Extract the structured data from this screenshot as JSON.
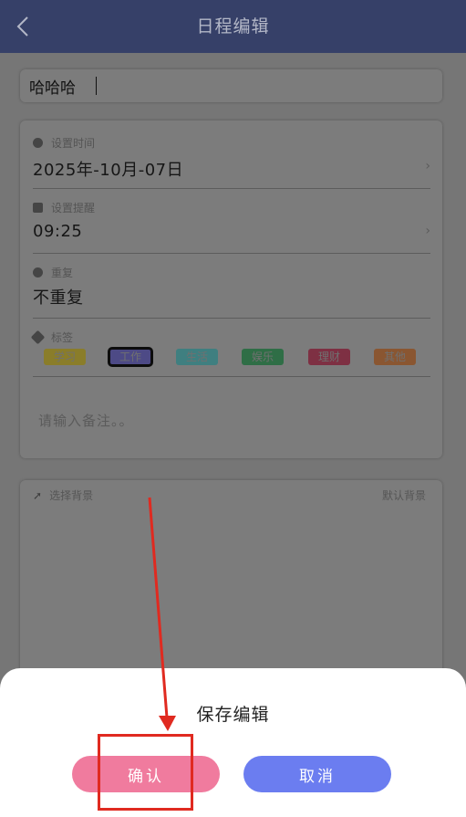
{
  "header": {
    "back_icon": "chevron-left-icon",
    "title": "日程编辑"
  },
  "title_field": {
    "value": "哈哈哈"
  },
  "schedule": {
    "time": {
      "label": "设置时间",
      "value": "2025年-10月-07日",
      "icon": "clock-icon"
    },
    "reminder": {
      "label": "设置提醒",
      "value": "09:25",
      "icon": "bell-icon"
    },
    "repeat": {
      "label": "重复",
      "value": "不重复",
      "icon": "repeat-icon"
    },
    "tags": {
      "label": "标签",
      "icon": "pin-icon",
      "items": [
        {
          "label": "学习",
          "color": "#8a7d2a",
          "selected": false
        },
        {
          "label": "工作",
          "color": "#4d4a86",
          "selected": true
        },
        {
          "label": "生活",
          "color": "#3f7f80",
          "selected": false
        },
        {
          "label": "娱乐",
          "color": "#2f6e46",
          "selected": false
        },
        {
          "label": "理财",
          "color": "#7e3043",
          "selected": false
        },
        {
          "label": "其他",
          "color": "#8a5631",
          "selected": false
        }
      ]
    },
    "note_placeholder": "请输入备注。。"
  },
  "background": {
    "label": "选择背景",
    "icon": "rocket-icon",
    "default_label": "默认背景"
  },
  "dialog": {
    "title": "保存编辑",
    "confirm_label": "确认",
    "cancel_label": "取消",
    "confirm_color": "#f07b9e",
    "cancel_color": "#6b7df0"
  },
  "annotation": {
    "color": "#e02a20"
  }
}
